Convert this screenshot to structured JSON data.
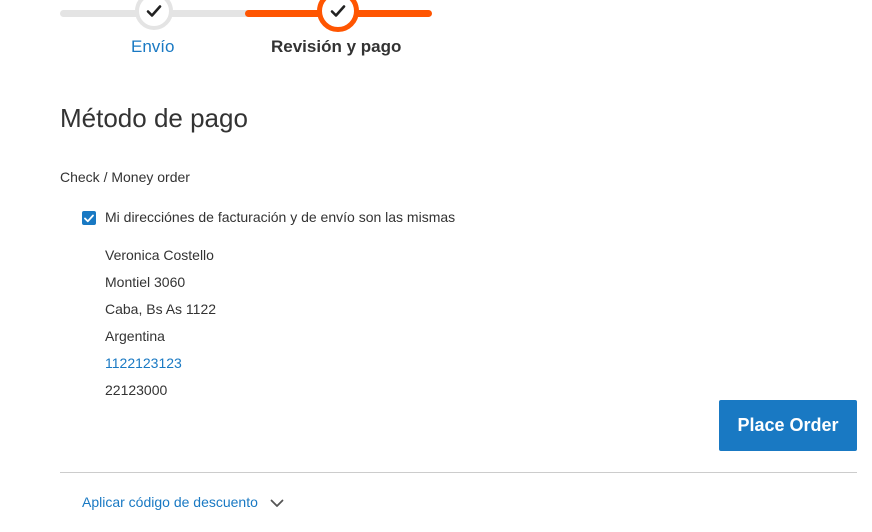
{
  "progress": {
    "steps": [
      {
        "label": "Envío",
        "state": "complete"
      },
      {
        "label": "Revisión y pago",
        "state": "active"
      }
    ]
  },
  "payment": {
    "title": "Método de pago",
    "method_label": "Check / Money order",
    "same_address_label": "Mi direcciónes de facturación y de envío son las mismas",
    "same_address_checked": true,
    "address": {
      "name": "Veronica Costello",
      "street": "Montiel 3060",
      "city_line": "Caba, Bs As 1122",
      "country": "Argentina",
      "phone": "1122123123",
      "extra": "22123000"
    },
    "place_order_label": "Place Order"
  },
  "discount": {
    "label": "Aplicar código de descuento"
  },
  "colors": {
    "accent": "#1979c3",
    "progress_active": "#ff5501",
    "progress_done": "#e4e4e4"
  },
  "icons": {
    "step_check": "checkmark-icon",
    "expand": "chevron-down-icon"
  }
}
